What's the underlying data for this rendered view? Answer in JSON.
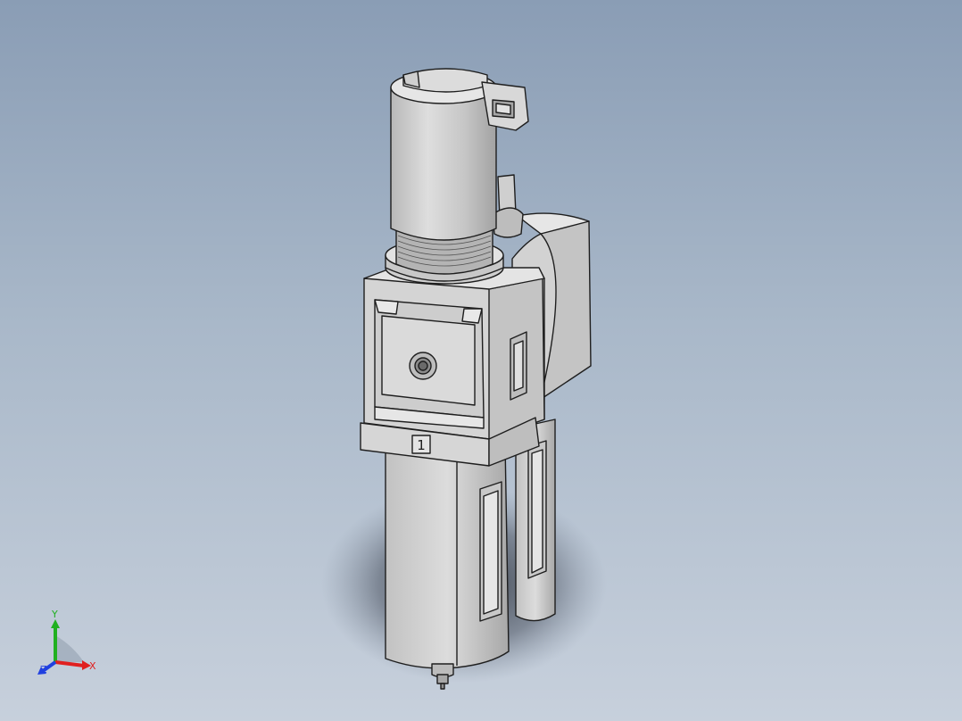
{
  "viewport": {
    "background_top": "#8a9db5",
    "background_bottom": "#c7d0dc"
  },
  "model": {
    "port_label": "1",
    "body_color": "#d6d6d6",
    "edge_color": "#1e1e1e"
  },
  "triad": {
    "x_label": "X",
    "y_label": "Y",
    "z_label": "Z",
    "x_color": "#e02020",
    "y_color": "#20b020",
    "z_color": "#2040e0"
  }
}
